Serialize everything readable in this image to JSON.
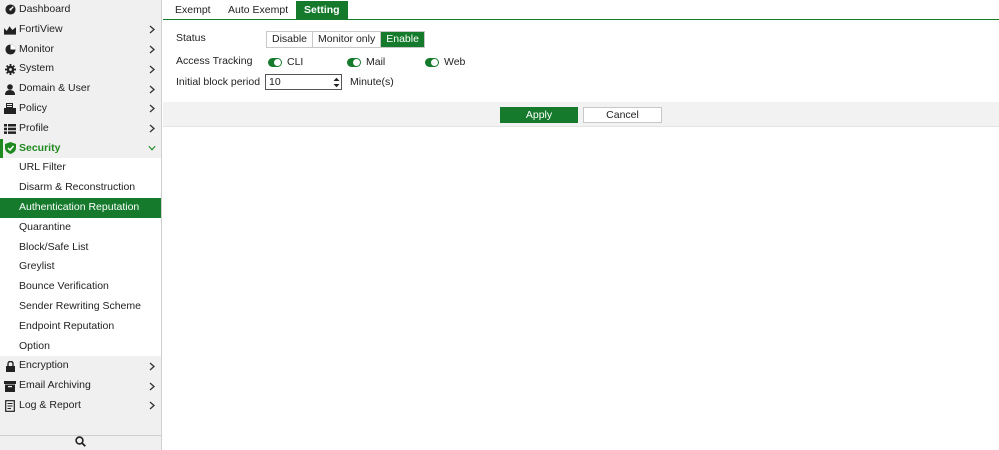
{
  "sidebar": {
    "items": [
      {
        "label": "Dashboard",
        "icon": "dashboard-icon"
      },
      {
        "label": "FortiView",
        "icon": "fortiview-icon"
      },
      {
        "label": "Monitor",
        "icon": "monitor-icon"
      },
      {
        "label": "System",
        "icon": "gear-icon"
      },
      {
        "label": "Domain & User",
        "icon": "user-icon"
      },
      {
        "label": "Policy",
        "icon": "policy-icon"
      },
      {
        "label": "Profile",
        "icon": "list-icon"
      },
      {
        "label": "Security",
        "icon": "shield-icon"
      },
      {
        "label": "Encryption",
        "icon": "lock-icon"
      },
      {
        "label": "Email Archiving",
        "icon": "archive-icon"
      },
      {
        "label": "Log & Report",
        "icon": "report-icon"
      }
    ],
    "security_children": [
      "URL Filter",
      "Disarm & Reconstruction",
      "Authentication Reputation",
      "Quarantine",
      "Block/Safe List",
      "Greylist",
      "Bounce Verification",
      "Sender Rewriting Scheme",
      "Endpoint Reputation",
      "Option"
    ],
    "active_child": "Authentication Reputation"
  },
  "tabs": [
    {
      "label": "Exempt",
      "active": false
    },
    {
      "label": "Auto Exempt",
      "active": false
    },
    {
      "label": "Setting",
      "active": true
    }
  ],
  "form": {
    "status_label": "Status",
    "status_options": [
      "Disable",
      "Monitor only",
      "Enable"
    ],
    "status_selected": "Enable",
    "tracking_label": "Access Tracking",
    "tracking_toggles": [
      {
        "label": "CLI",
        "on": true
      },
      {
        "label": "Mail",
        "on": true
      },
      {
        "label": "Web",
        "on": true
      }
    ],
    "period_label": "Initial block period",
    "period_value": "10",
    "period_unit": "Minute(s)"
  },
  "actions": {
    "apply": "Apply",
    "cancel": "Cancel"
  },
  "colors": {
    "accent": "#157a2c",
    "sidebar_bg": "#f0f0f0"
  }
}
